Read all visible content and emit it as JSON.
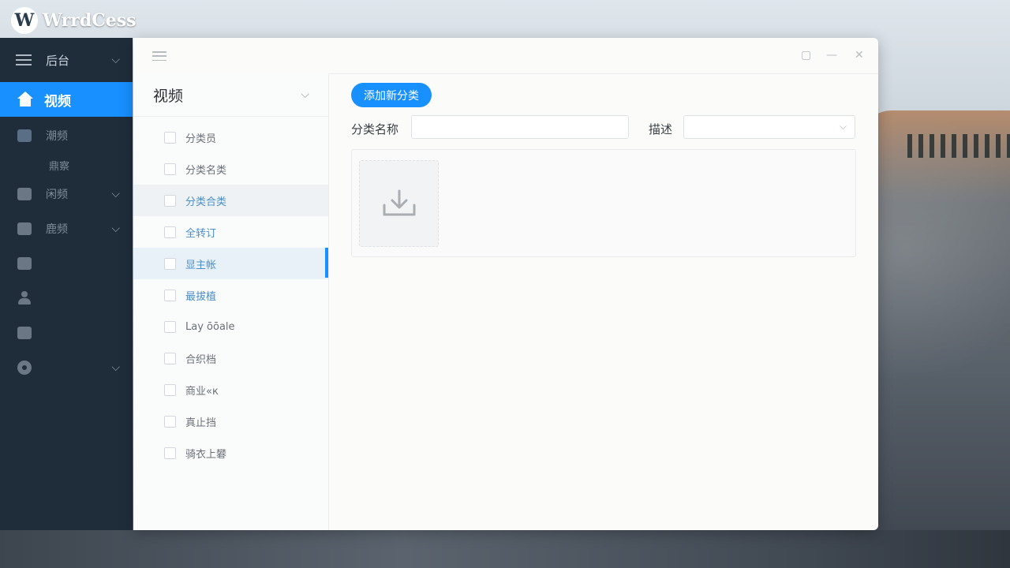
{
  "brand": {
    "name": "WrrdCess",
    "mark": "W"
  },
  "nav": {
    "header_title": "后台",
    "active_label": "视频",
    "items": [
      {
        "label": "潮频",
        "icon": "monitor-icon",
        "has_chevron": false
      },
      {
        "label": "鼎察",
        "icon": "",
        "sub": true
      },
      {
        "label": "闲频",
        "icon": "video-icon",
        "has_chevron": true
      },
      {
        "label": "鹿频",
        "icon": "desktop-icon",
        "has_chevron": true
      },
      {
        "label": "",
        "icon": "grid-icon",
        "has_chevron": false
      },
      {
        "label": "",
        "icon": "user-icon",
        "has_chevron": false
      },
      {
        "label": "",
        "icon": "card-icon",
        "has_chevron": false
      },
      {
        "label": "",
        "icon": "gear-icon",
        "has_chevron": true
      }
    ]
  },
  "window": {
    "controls": {
      "maximize": "▢",
      "minimize": "—",
      "close": "✕"
    }
  },
  "category_panel": {
    "title": "视频",
    "items": [
      {
        "label": "分类员"
      },
      {
        "label": "分类名类"
      },
      {
        "label": "分类合类"
      },
      {
        "label": "全转订"
      },
      {
        "label": "显主帐"
      },
      {
        "label": "最拔植"
      },
      {
        "label": "Lay ōōale"
      },
      {
        "label": "合织档"
      },
      {
        "label": "商业«к"
      },
      {
        "label": "真止挡"
      },
      {
        "label": "骑衣上礬"
      }
    ]
  },
  "content": {
    "add_button": "添加新分类",
    "name_label": "分类名称",
    "name_value": "",
    "desc_label": "描述",
    "desc_value": ""
  },
  "colors": {
    "accent": "#1890ff",
    "nav_bg": "#1f2d3b"
  }
}
